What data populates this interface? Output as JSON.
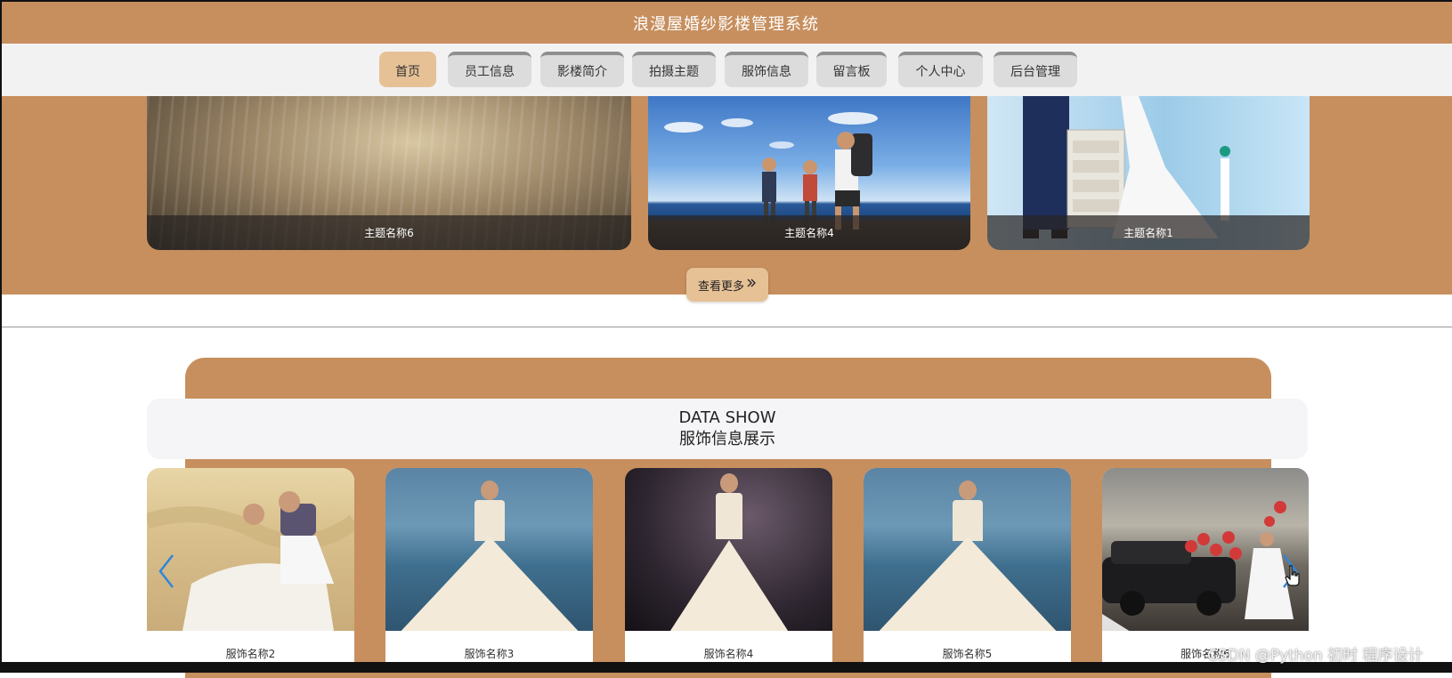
{
  "header": {
    "title": "浪漫屋婚纱影楼管理系统"
  },
  "nav": {
    "items": [
      {
        "label": "首页",
        "active": true
      },
      {
        "label": "员工信息"
      },
      {
        "label": "影楼简介"
      },
      {
        "label": "拍摄主题"
      },
      {
        "label": "服饰信息"
      },
      {
        "label": "留言板"
      },
      {
        "label": "个人中心"
      },
      {
        "label": "后台管理"
      }
    ]
  },
  "themes": {
    "cards": [
      {
        "caption": "主题名称6"
      },
      {
        "caption": "主题名称4"
      },
      {
        "caption": "主题名称1"
      }
    ],
    "more_label": "查看更多",
    "more_icon": "double-chevron-right-icon"
  },
  "dress_show": {
    "title_en": "DATA SHOW",
    "title_cn": "服饰信息展示",
    "items": [
      {
        "label": "服饰名称2"
      },
      {
        "label": "服饰名称3"
      },
      {
        "label": "服饰名称4"
      },
      {
        "label": "服饰名称5"
      },
      {
        "label": "服饰名称6"
      }
    ],
    "prev_icon": "chevron-left-icon",
    "next_icon": "chevron-right-icon"
  },
  "watermark": "CSDN @Python 初时 程序设计",
  "colors": {
    "brand": "#c78f5e",
    "accent": "#e6c196",
    "nav_bg": "#f3f2f3",
    "arrow": "#2f86d8"
  }
}
